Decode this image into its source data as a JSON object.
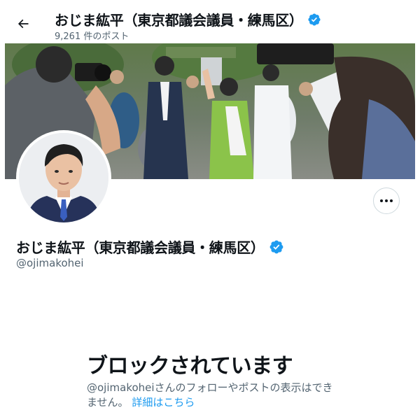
{
  "header": {
    "title": "おじま紘平（東京都議会議員・練馬区）",
    "post_count": "9,261 件のポスト"
  },
  "profile": {
    "display_name": "おじま紘平（東京都議会議員・練馬区）",
    "handle": "@ojimakohei",
    "verified": true
  },
  "blocked": {
    "title": "ブロックされています",
    "description": "@ojimakoheiさんのフォローやポストの表示はできません。",
    "details_link": "詳細はこちら"
  },
  "icons": {
    "back": "arrow-left-icon",
    "verified": "verified-badge-icon",
    "more": "more-horizontal-icon"
  },
  "colors": {
    "accent": "#1d9bf0",
    "text_primary": "#0f1419",
    "text_secondary": "#536471",
    "border": "#cfd9de"
  }
}
